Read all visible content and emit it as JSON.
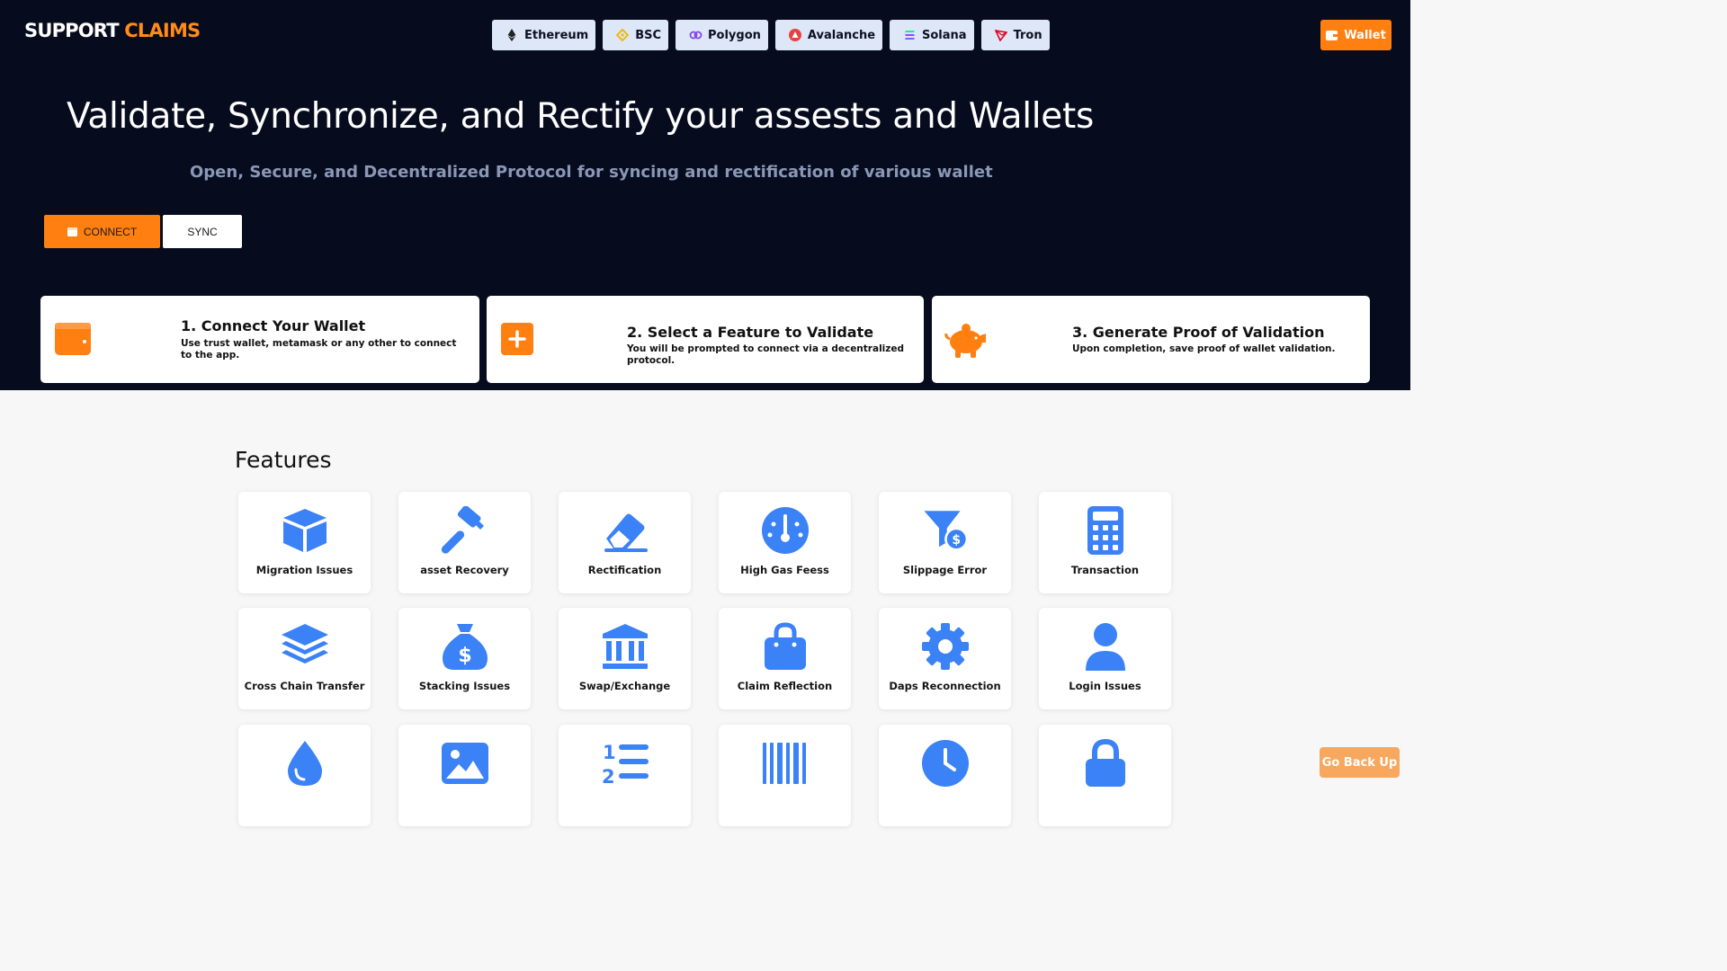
{
  "header": {
    "logo_primary": "SUPPORT",
    "logo_accent": "CLAIMS",
    "wallet_label": "Wallet"
  },
  "chains": [
    {
      "label": "Ethereum",
      "icon": "ethereum-icon"
    },
    {
      "label": "BSC",
      "icon": "bsc-icon"
    },
    {
      "label": "Polygon",
      "icon": "polygon-icon"
    },
    {
      "label": "Avalanche",
      "icon": "avalanche-icon"
    },
    {
      "label": "Solana",
      "icon": "solana-icon"
    },
    {
      "label": "Tron",
      "icon": "tron-icon"
    }
  ],
  "hero": {
    "headline": "Validate, Synchronize, and Rectify your assests and Wallets",
    "subline": "Open, Secure, and Decentralized Protocol for syncing and rectification of various wallet",
    "connect_label": "CONNECT",
    "sync_label": "SYNC"
  },
  "steps": [
    {
      "title": "1. Connect Your Wallet",
      "desc": "Use trust wallet, metamask or any other to connect to the app.",
      "icon": "wallet-icon"
    },
    {
      "title": "2. Select a Feature to Validate",
      "desc": "You will be prompted to connect via a decentralized protocol.",
      "icon": "plus-square-icon"
    },
    {
      "title": "3. Generate Proof of Validation",
      "desc": "Upon completion, save proof of wallet validation.",
      "icon": "piggy-bank-icon"
    }
  ],
  "features": {
    "title": "Features",
    "items": [
      {
        "label": "Migration Issues",
        "icon": "cube-icon"
      },
      {
        "label": "asset Recovery",
        "icon": "hammer-icon"
      },
      {
        "label": "Rectification",
        "icon": "eraser-icon"
      },
      {
        "label": "High Gas Feess",
        "icon": "gauge-icon"
      },
      {
        "label": "Slippage Error",
        "icon": "funnel-dollar-icon"
      },
      {
        "label": "Transaction",
        "icon": "calculator-icon"
      },
      {
        "label": "Cross Chain Transfer",
        "icon": "layers-icon"
      },
      {
        "label": "Stacking Issues",
        "icon": "money-bag-icon"
      },
      {
        "label": "Swap/Exchange",
        "icon": "bank-icon"
      },
      {
        "label": "Claim Reflection",
        "icon": "shopping-bag-icon"
      },
      {
        "label": "Daps Reconnection",
        "icon": "gear-icon"
      },
      {
        "label": "Login Issues",
        "icon": "user-icon"
      },
      {
        "label": "",
        "icon": "droplet-icon"
      },
      {
        "label": "",
        "icon": "image-icon"
      },
      {
        "label": "",
        "icon": "numbered-list-icon"
      },
      {
        "label": "",
        "icon": "barcode-icon"
      },
      {
        "label": "",
        "icon": "clock-icon"
      },
      {
        "label": "",
        "icon": "lock-icon"
      }
    ]
  },
  "go_back_label": "Go Back Up",
  "colors": {
    "hero_bg": "#070b1e",
    "accent": "#ff7f11",
    "icon_blue": "#3b82f6",
    "chain_bg": "#dde7f7"
  }
}
